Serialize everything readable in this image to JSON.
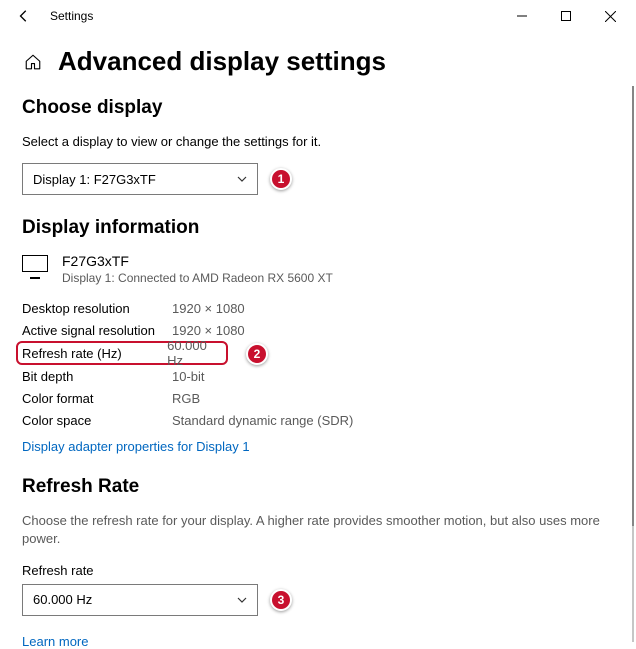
{
  "titlebar": {
    "app_title": "Settings"
  },
  "page": {
    "heading": "Advanced display settings"
  },
  "choose": {
    "heading": "Choose display",
    "description": "Select a display to view or change the settings for it.",
    "dropdown_value": "Display 1: F27G3xTF",
    "badge": "1"
  },
  "info": {
    "heading": "Display information",
    "display_name": "F27G3xTF",
    "display_connection": "Display 1: Connected to AMD Radeon RX 5600 XT",
    "rows": {
      "desktop_res": {
        "label": "Desktop resolution",
        "value": "1920 × 1080"
      },
      "signal_res": {
        "label": "Active signal resolution",
        "value": "1920 × 1080"
      },
      "refresh": {
        "label": "Refresh rate (Hz)",
        "value": "60.000 Hz",
        "badge": "2"
      },
      "bit_depth": {
        "label": "Bit depth",
        "value": "10-bit"
      },
      "color_format": {
        "label": "Color format",
        "value": "RGB"
      },
      "color_space": {
        "label": "Color space",
        "value": "Standard dynamic range (SDR)"
      }
    },
    "adapter_link": "Display adapter properties for Display 1"
  },
  "refresh": {
    "heading": "Refresh Rate",
    "description": "Choose the refresh rate for your display. A higher rate provides smoother motion, but also uses more power.",
    "field_label": "Refresh rate",
    "dropdown_value": "60.000 Hz",
    "badge": "3",
    "learn_more": "Learn more"
  }
}
